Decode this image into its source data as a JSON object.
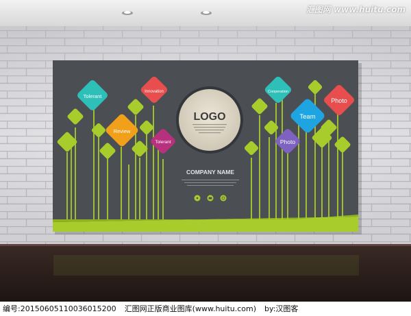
{
  "watermark": {
    "text": "汇图网 www.huitu.com"
  },
  "board": {
    "logo": "LOGO",
    "company_name": "COMPANY NAME"
  },
  "tiles": {
    "tolerant_top": "Tolerant",
    "innovation": "Innovation",
    "review": "Review",
    "tolerant_mid": "Tolerant",
    "cooperation": "Cooperation",
    "photo_right": "Photo",
    "team": "Team",
    "photo_mid": "Photo"
  },
  "footer": {
    "id_text": "编号:20150605110036015200",
    "site_text": "汇图网正版商业图库(www.huitu.com)",
    "author_text": "by:汉图客"
  },
  "colors": {
    "board": "#4b4e53",
    "green": "#a8cc2b",
    "teal": "#2ebfb8",
    "red": "#e84e4d",
    "orange": "#f0a01a",
    "magenta": "#b8317e",
    "sky": "#1fa4e2",
    "purple": "#7d62c0",
    "cream": "#dcd5c6"
  }
}
